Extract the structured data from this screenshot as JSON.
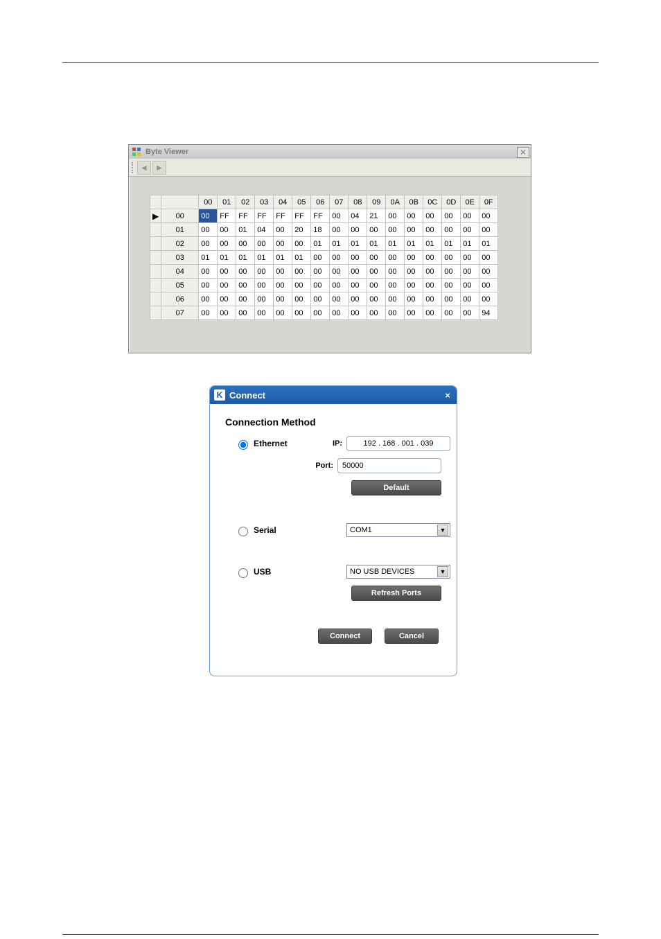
{
  "byte_viewer": {
    "title": "Byte Viewer",
    "close_glyph": "✕",
    "toolbar": {
      "back_glyph": "◄",
      "fwd_glyph": "►"
    },
    "col_headers": [
      "00",
      "01",
      "02",
      "03",
      "04",
      "05",
      "06",
      "07",
      "08",
      "09",
      "0A",
      "0B",
      "0C",
      "0D",
      "0E",
      "0F"
    ],
    "row_headers": [
      "00",
      "01",
      "02",
      "03",
      "04",
      "05",
      "06",
      "07"
    ],
    "selected_row": 0,
    "selected_col": 0,
    "selected_glyph": "▶",
    "rows": [
      [
        "00",
        "FF",
        "FF",
        "FF",
        "FF",
        "FF",
        "FF",
        "00",
        "04",
        "21",
        "00",
        "00",
        "00",
        "00",
        "00",
        "00"
      ],
      [
        "00",
        "00",
        "01",
        "04",
        "00",
        "20",
        "18",
        "00",
        "00",
        "00",
        "00",
        "00",
        "00",
        "00",
        "00",
        "00"
      ],
      [
        "00",
        "00",
        "00",
        "00",
        "00",
        "00",
        "01",
        "01",
        "01",
        "01",
        "01",
        "01",
        "01",
        "01",
        "01",
        "01"
      ],
      [
        "01",
        "01",
        "01",
        "01",
        "01",
        "01",
        "00",
        "00",
        "00",
        "00",
        "00",
        "00",
        "00",
        "00",
        "00",
        "00"
      ],
      [
        "00",
        "00",
        "00",
        "00",
        "00",
        "00",
        "00",
        "00",
        "00",
        "00",
        "00",
        "00",
        "00",
        "00",
        "00",
        "00"
      ],
      [
        "00",
        "00",
        "00",
        "00",
        "00",
        "00",
        "00",
        "00",
        "00",
        "00",
        "00",
        "00",
        "00",
        "00",
        "00",
        "00"
      ],
      [
        "00",
        "00",
        "00",
        "00",
        "00",
        "00",
        "00",
        "00",
        "00",
        "00",
        "00",
        "00",
        "00",
        "00",
        "00",
        "00"
      ],
      [
        "00",
        "00",
        "00",
        "00",
        "00",
        "00",
        "00",
        "00",
        "00",
        "00",
        "00",
        "00",
        "00",
        "00",
        "00",
        "94"
      ]
    ]
  },
  "connect": {
    "title": "Connect",
    "close_glyph": "×",
    "heading": "Connection Method",
    "methods": {
      "ethernet": {
        "label": "Ethernet",
        "selected": true
      },
      "serial": {
        "label": "Serial",
        "selected": false
      },
      "usb": {
        "label": "USB",
        "selected": false
      }
    },
    "ip": {
      "label": "IP:",
      "value": "192 . 168 . 001 . 039"
    },
    "port": {
      "label": "Port:",
      "value": "50000"
    },
    "default_btn": "Default",
    "serial_port": {
      "value": "COM1"
    },
    "usb_device": {
      "value": "NO USB DEVICES"
    },
    "refresh_btn": "Refresh Ports",
    "connect_btn": "Connect",
    "cancel_btn": "Cancel"
  }
}
